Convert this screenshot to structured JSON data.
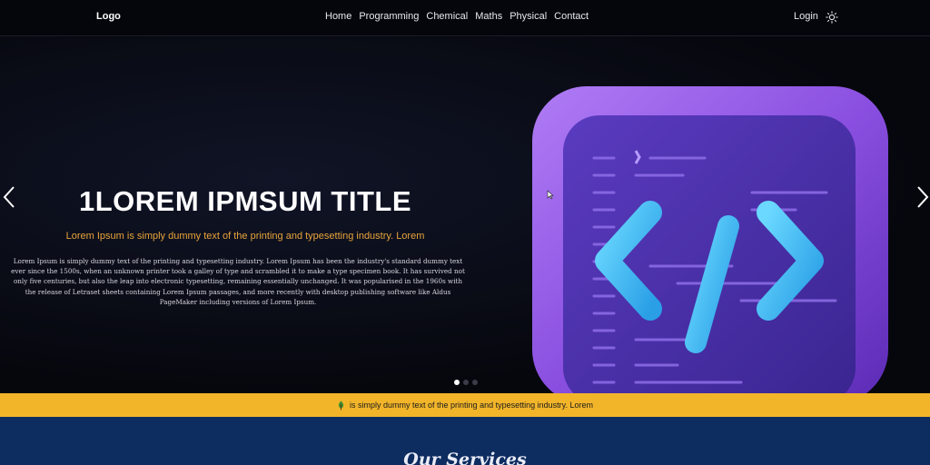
{
  "navbar": {
    "logo": "Logo",
    "links": [
      "Home",
      "Programming",
      "Chemical",
      "Maths",
      "Physical",
      "Contact"
    ],
    "login": "Login",
    "theme_icon": "sun-icon"
  },
  "hero": {
    "title": "1LOREM IPMSUM TITLE",
    "subtitle": "Lorem Ipsum is simply dummy text of the printing and typesetting industry. Lorem",
    "body": "Lorem Ipsum is simply dummy text of the printing and typesetting industry. Lorem Ipsum has been the industry's standard dummy text ever since the 1500s, when an unknown printer took a galley of type and scrambled it to make a type specimen book. It has survived not only five centuries, but also the leap into electronic typesetting, remaining essentially unchanged. It was popularised in the 1960s with the release of Letraset sheets containing Lorem Ipsum passages, and more recently with desktop publishing software like Aldus PageMaker including versions of Lorem Ipsum.",
    "image_icon": "code-icon",
    "slide_count": 3,
    "active_slide": 1
  },
  "ticker": {
    "icon": "leaf-icon",
    "text": "is simply dummy text of the printing and typesetting industry. Lorem"
  },
  "services": {
    "heading": "Our Services"
  },
  "colors": {
    "accent_orange": "#e8a43a",
    "ticker_yellow": "#f2b52a",
    "services_blue": "#0d2c60",
    "icon_purple": "#8a4fe0",
    "icon_cyan": "#3fc3f0"
  }
}
